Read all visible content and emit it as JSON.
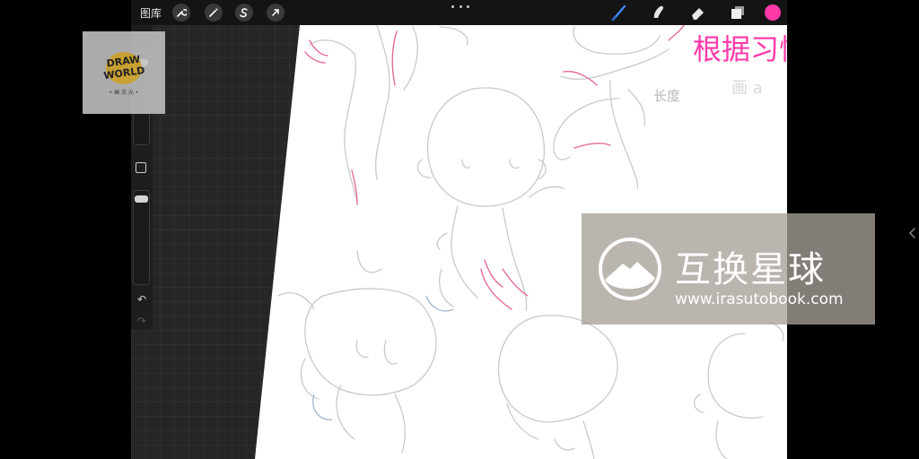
{
  "toolbar": {
    "gallery_label": "图库",
    "actions_icon": "wrench-icon",
    "adjustments_icon": "magic-wand-icon",
    "selection_icon": "selection-s-icon",
    "transform_icon": "arrow-cursor-icon",
    "brush_icon": "brush-pen-icon",
    "smudge_icon": "smudge-finger-icon",
    "eraser_icon": "eraser-icon",
    "layers_icon": "layers-icon",
    "current_color": "#ff3aa8"
  },
  "sidebar": {
    "brush_size_level": 0.95,
    "opacity_level": 0.97,
    "undo_icon": "undo-icon",
    "redo_icon": "redo-icon"
  },
  "logo": {
    "line1": "DRAW",
    "line2": "WORLD",
    "tagline": "• 画 次 元 •"
  },
  "canvas": {
    "annotation_main": "根据习惯",
    "annotation_side": "长度",
    "annotation_faint": "画 a"
  },
  "watermark": {
    "title": "互换星球",
    "url": "www.irasutobook.com"
  },
  "colors": {
    "accent_pink": "#ff3aa8",
    "brush_blue": "#3f8cff",
    "workspace": "#262629"
  }
}
